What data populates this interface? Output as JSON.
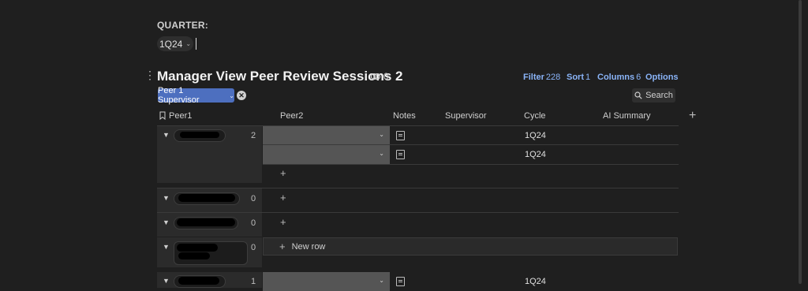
{
  "filter": {
    "label": "QUARTER:",
    "value": "1Q24"
  },
  "view": {
    "title": "Manager View Peer Review Sessions 2",
    "link_count": "0",
    "toolbar": {
      "filter_label": "Filter",
      "filter_count": "228",
      "sort_label": "Sort",
      "sort_count": "1",
      "columns_label": "Columns",
      "columns_count": "6",
      "options_label": "Options"
    },
    "group_chip": "Peer 1 Supervisor",
    "search_label": "Search"
  },
  "columns": [
    "Peer1",
    "Peer2",
    "Notes",
    "Supervisor",
    "Cycle",
    "AI Summary"
  ],
  "groups": [
    {
      "count": "2",
      "rows": [
        {
          "cycle": "1Q24"
        },
        {
          "cycle": "1Q24"
        }
      ]
    },
    {
      "count": "0"
    },
    {
      "count": "0"
    },
    {
      "count": "0",
      "new_row_label": "New row"
    },
    {
      "count": "1",
      "rows": [
        {
          "cycle": "1Q24"
        }
      ]
    }
  ]
}
